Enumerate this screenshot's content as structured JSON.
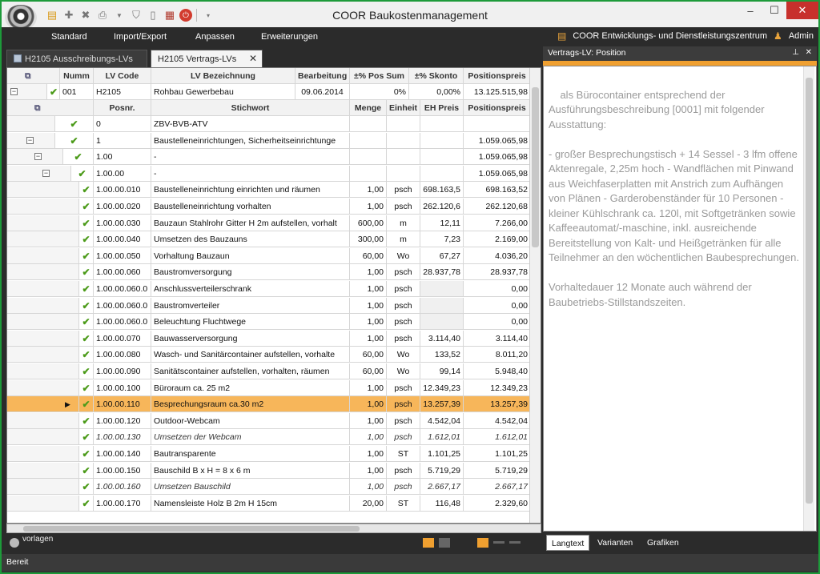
{
  "window": {
    "title": "COOR Baukostenmanagement"
  },
  "menu": {
    "items": [
      "Standard",
      "Import/Export",
      "Anpassen",
      "Erweiterungen"
    ]
  },
  "user": {
    "company": "COOR Entwicklungs- und Dienstleistungszentrum",
    "name": "Admin"
  },
  "tabs": {
    "inactive": "H2105 Ausschreibungs-LVs",
    "active": "H2105 Vertrags-LVs"
  },
  "lv_header": {
    "columns": [
      "Numm",
      "LV Code",
      "LV Bezeichnung",
      "Bearbeitung",
      "±% Pos Sum",
      "±% Skonto",
      "Positionspreis"
    ],
    "row": [
      "001",
      "H2105",
      "Rohbau Gewerbebau",
      "09.06.2014",
      "0%",
      "0,00%",
      "13.125.515,98"
    ]
  },
  "pos_header": {
    "columns": [
      "Posnr.",
      "Stichwort",
      "Menge",
      "Einheit",
      "EH Preis",
      "Positionspreis"
    ]
  },
  "rows": [
    {
      "posnr": "0",
      "stichwort": "ZBV-BVB-ATV",
      "menge": "",
      "einheit": "",
      "eh": "",
      "preis": "",
      "level": 0,
      "italic": false,
      "hl": false
    },
    {
      "posnr": "1",
      "stichwort": "Baustelleneinrichtungen, Sicherheitseinrichtunge",
      "menge": "",
      "einheit": "",
      "eh": "",
      "preis": "1.059.065,98",
      "level": 0,
      "italic": false,
      "hl": false
    },
    {
      "posnr": "1.00",
      "stichwort": "-",
      "menge": "",
      "einheit": "",
      "eh": "",
      "preis": "1.059.065,98",
      "level": 1,
      "italic": false,
      "hl": false
    },
    {
      "posnr": "1.00.00",
      "stichwort": "-",
      "menge": "",
      "einheit": "",
      "eh": "",
      "preis": "1.059.065,98",
      "level": 2,
      "italic": false,
      "hl": false
    },
    {
      "posnr": "1.00.00.010",
      "stichwort": "Baustelleneinrichtung einrichten und räumen",
      "menge": "1,00",
      "einheit": "psch",
      "eh": "698.163,5",
      "preis": "698.163,52",
      "level": 3,
      "italic": false,
      "hl": false
    },
    {
      "posnr": "1.00.00.020",
      "stichwort": "Baustelleneinrichtung vorhalten",
      "menge": "1,00",
      "einheit": "psch",
      "eh": "262.120,6",
      "preis": "262.120,68",
      "level": 3,
      "italic": false,
      "hl": false
    },
    {
      "posnr": "1.00.00.030",
      "stichwort": "Bauzaun Stahlrohr Gitter H 2m aufstellen, vorhalt",
      "menge": "600,00",
      "einheit": "m",
      "eh": "12,11",
      "preis": "7.266,00",
      "level": 3,
      "italic": false,
      "hl": false
    },
    {
      "posnr": "1.00.00.040",
      "stichwort": "Umsetzen des Bauzauns",
      "menge": "300,00",
      "einheit": "m",
      "eh": "7,23",
      "preis": "2.169,00",
      "level": 3,
      "italic": false,
      "hl": false
    },
    {
      "posnr": "1.00.00.050",
      "stichwort": "Vorhaltung Bauzaun",
      "menge": "60,00",
      "einheit": "Wo",
      "eh": "67,27",
      "preis": "4.036,20",
      "level": 3,
      "italic": false,
      "hl": false
    },
    {
      "posnr": "1.00.00.060",
      "stichwort": "Baustromversorgung",
      "menge": "1,00",
      "einheit": "psch",
      "eh": "28.937,78",
      "preis": "28.937,78",
      "level": 3,
      "italic": false,
      "hl": false
    },
    {
      "posnr": "1.00.00.060.0",
      "stichwort": "Anschlussverteilerschrank",
      "menge": "1,00",
      "einheit": "psch",
      "eh": "",
      "preis": "0,00",
      "level": 3,
      "italic": false,
      "hl": false
    },
    {
      "posnr": "1.00.00.060.0",
      "stichwort": "Baustromverteiler",
      "menge": "1,00",
      "einheit": "psch",
      "eh": "",
      "preis": "0,00",
      "level": 3,
      "italic": false,
      "hl": false
    },
    {
      "posnr": "1.00.00.060.0",
      "stichwort": "Beleuchtung Fluchtwege",
      "menge": "1,00",
      "einheit": "psch",
      "eh": "",
      "preis": "0,00",
      "level": 3,
      "italic": false,
      "hl": false
    },
    {
      "posnr": "1.00.00.070",
      "stichwort": "Bauwasserversorgung",
      "menge": "1,00",
      "einheit": "psch",
      "eh": "3.114,40",
      "preis": "3.114,40",
      "level": 3,
      "italic": false,
      "hl": false
    },
    {
      "posnr": "1.00.00.080",
      "stichwort": "Wasch- und Sanitärcontainer aufstellen, vorhalte",
      "menge": "60,00",
      "einheit": "Wo",
      "eh": "133,52",
      "preis": "8.011,20",
      "level": 3,
      "italic": false,
      "hl": false
    },
    {
      "posnr": "1.00.00.090",
      "stichwort": "Sanitätscontainer aufstellen, vorhalten, räumen",
      "menge": "60,00",
      "einheit": "Wo",
      "eh": "99,14",
      "preis": "5.948,40",
      "level": 3,
      "italic": false,
      "hl": false
    },
    {
      "posnr": "1.00.00.100",
      "stichwort": "Büroraum ca. 25 m2",
      "menge": "1,00",
      "einheit": "psch",
      "eh": "12.349,23",
      "preis": "12.349,23",
      "level": 3,
      "italic": false,
      "hl": false
    },
    {
      "posnr": "1.00.00.110",
      "stichwort": "Besprechungsraum ca.30 m2",
      "menge": "1,00",
      "einheit": "psch",
      "eh": "13.257,39",
      "preis": "13.257,39",
      "level": 3,
      "italic": false,
      "hl": true
    },
    {
      "posnr": "1.00.00.120",
      "stichwort": "Outdoor-Webcam",
      "menge": "1,00",
      "einheit": "psch",
      "eh": "4.542,04",
      "preis": "4.542,04",
      "level": 3,
      "italic": false,
      "hl": false
    },
    {
      "posnr": "1.00.00.130",
      "stichwort": "Umsetzen der Webcam",
      "menge": "1,00",
      "einheit": "psch",
      "eh": "1.612,01",
      "preis": "1.612,01",
      "level": 3,
      "italic": true,
      "hl": false
    },
    {
      "posnr": "1.00.00.140",
      "stichwort": "Bautransparente",
      "menge": "1,00",
      "einheit": "ST",
      "eh": "1.101,25",
      "preis": "1.101,25",
      "level": 3,
      "italic": false,
      "hl": false
    },
    {
      "posnr": "1.00.00.150",
      "stichwort": "Bauschild B x H = 8 x 6 m",
      "menge": "1,00",
      "einheit": "psch",
      "eh": "5.719,29",
      "preis": "5.719,29",
      "level": 3,
      "italic": false,
      "hl": false
    },
    {
      "posnr": "1.00.00.160",
      "stichwort": "Umsetzen Bauschild",
      "menge": "1,00",
      "einheit": "psch",
      "eh": "2.667,17",
      "preis": "2.667,17",
      "level": 3,
      "italic": true,
      "hl": false
    },
    {
      "posnr": "1.00.00.170",
      "stichwort": "Namensleiste Holz B 2m H 15cm",
      "menge": "20,00",
      "einheit": "ST",
      "eh": "116,48",
      "preis": "2.329,60",
      "level": 3,
      "italic": false,
      "hl": false
    }
  ],
  "right_panel": {
    "title": "Vertrags-LV: Position",
    "text": "als Bürocontainer entsprechend der Ausführungsbeschreibung [0001] mit folgender Ausstattung:\n\n- großer Besprechungstisch + 14 Sessel - 3 lfm offene Aktenregale, 2,25m hoch - Wandflächen mit Pinwand aus Weichfaserplatten mit Anstrich zum Aufhängen von Plänen - Garderobenständer für 10 Personen - kleiner Kühlschrank ca. 120l, mit Softgetränken sowie Kaffeeautomat/-maschine, inkl. ausreichende Bereitstellung von Kalt- und Heißgetränken für alle Teilnehmer an den wöchentlichen Baubesprechungen.\n\nVorhaltedauer 12 Monate auch während der Baubetriebs-Stillstandszeiten.",
    "tabs": [
      "Langtext",
      "Varianten",
      "Grafiken"
    ]
  },
  "bottom": {
    "vorlagen": "vorlagen"
  },
  "status": {
    "text": "Bereit"
  },
  "colors": {
    "accent": "#f0a030",
    "highlight_row": "#f7b65a",
    "check": "#4c9b1a"
  }
}
